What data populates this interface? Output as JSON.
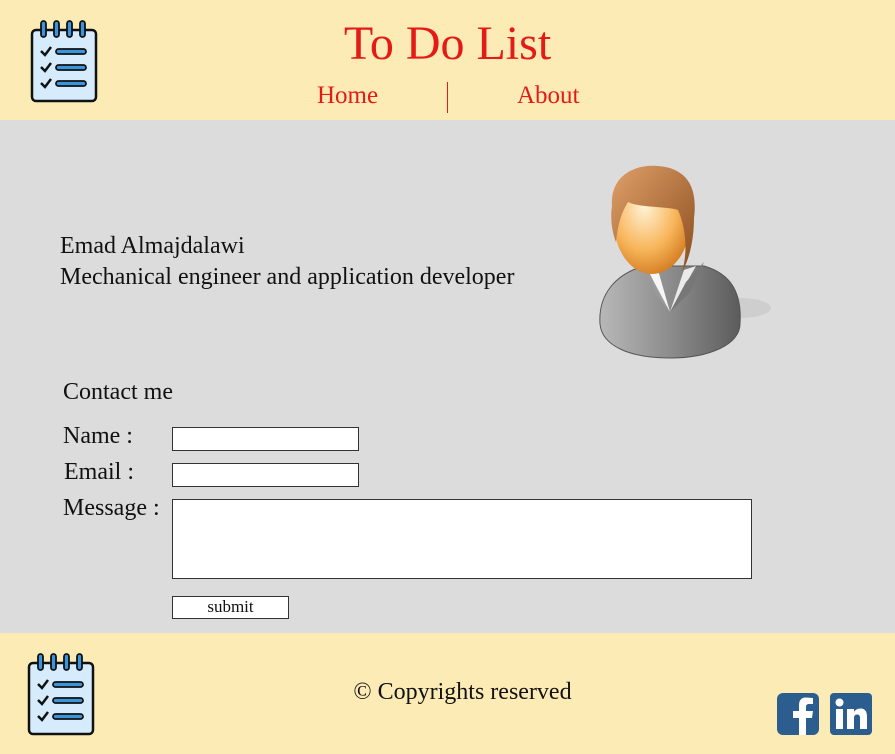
{
  "header": {
    "title": "To Do List",
    "nav": [
      {
        "label": "Home"
      },
      {
        "label": "About"
      }
    ]
  },
  "profile": {
    "name": "Emad Almajdalawi",
    "role": "Mechanical engineer and application developer"
  },
  "contact": {
    "heading": "Contact me",
    "name_label": "Name :",
    "email_label": "Email :",
    "message_label": "Message :",
    "name_value": "",
    "email_value": "",
    "message_value": "",
    "submit_label": "submit"
  },
  "footer": {
    "copyright": "© Copyrights reserved"
  },
  "icons": {
    "logo": "checklist-notepad-icon",
    "avatar": "user-avatar-icon",
    "facebook": "facebook-icon",
    "linkedin": "linkedin-icon"
  },
  "colors": {
    "header_bg": "#fdebb5",
    "body_bg": "#dcdcdc",
    "accent": "#e41a17",
    "social_blue": "#2b5d8f"
  }
}
